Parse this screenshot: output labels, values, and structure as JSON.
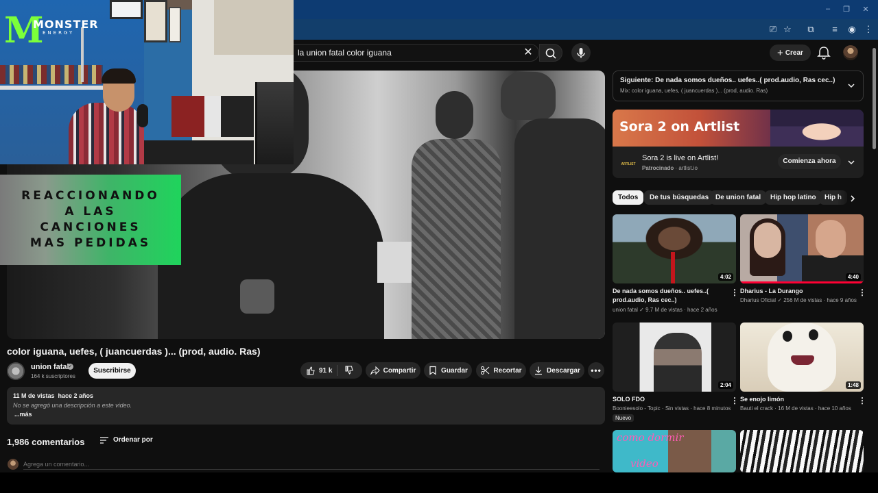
{
  "colors": {
    "background": "#0f0f0f",
    "chrome_tabstrip": "#0d3b72",
    "chrome_toolbar": "#123e6b",
    "pill": "#272727",
    "text_secondary": "#aaaaaa",
    "progress_red": "#ff0033",
    "logo_green": "#7cff3a",
    "banner_green": "#1fd45c"
  },
  "browser": {
    "window_controls": [
      "minimize-icon",
      "restore-icon",
      "close-icon"
    ],
    "toolbar_icons": [
      "cast-icon",
      "star-icon",
      "extensions-icon",
      "media-queue-icon",
      "profile-icon",
      "menu-icon"
    ]
  },
  "search": {
    "query": "la union fatal color iguana",
    "clear_icon": "close-icon",
    "search_icon": "search-icon",
    "mic_icon": "mic-icon"
  },
  "header": {
    "create_label": "Crear",
    "create_icon": "plus-icon",
    "notifications_icon": "bell-icon",
    "avatar_icon": "user-avatar"
  },
  "overlay": {
    "logo_mark": "M",
    "logo_text": "MONSTER",
    "logo_sub": "ENERGY",
    "banner_lines": [
      "REACCIONANDO",
      "A LAS",
      "CANCIONES",
      "MAS PEDIDAS"
    ]
  },
  "video": {
    "title": "color iguana, uefes, ( juancuerdas )... (prod, audio. Ras)",
    "channel": "union fatal",
    "subscribers": "164 k suscriptores",
    "subscribe_label": "Suscribirse",
    "likes": "91 k",
    "actions": {
      "share": "Compartir",
      "save": "Guardar",
      "clip": "Recortar",
      "download": "Descargar"
    }
  },
  "description": {
    "stats": "11 M de vistas  hace 2 años",
    "text": "No se agregó una descripción a este video.",
    "more": "...más"
  },
  "comments": {
    "count": "1,986 comentarios",
    "sort_label": "Ordenar por",
    "placeholder": "Agrega un comentario..."
  },
  "up_next": {
    "title": "Siguiente: De nada somos dueños.. uefes..( prod.audio, Ras cec..)",
    "subtitle": "Mix: color iguana, uefes, ( juancuerdas )... (prod, audio. Ras)"
  },
  "ad": {
    "image_text": "Sora 2 on Artlist",
    "logo_text": "ARTLIST",
    "title": "Sora 2 is live on Artlist!",
    "sponsor_label": "Patrocinado",
    "sponsor_domain": "artlist.io",
    "cta": "Comienza ahora"
  },
  "chips": [
    "Todos",
    "De tus búsquedas",
    "De union fatal",
    "Hip hop latino",
    "Hip h"
  ],
  "related": [
    {
      "title": "De nada somos dueños.. uefes..( prod.audio, Ras cec..)",
      "channel": "union fatal",
      "meta": "9.7 M de vistas · hace 2 años",
      "duration": "4:02"
    },
    {
      "title": "Dharius - La Durango",
      "channel": "Dharius Oficial",
      "meta": "256 M de vistas · hace 9 años",
      "duration": "4:40"
    },
    {
      "title": "SOLO FDO",
      "channel": "Boonieesolo - Topic",
      "meta": "Sin vistas · hace 8 minutos",
      "duration": "2:04",
      "badge": "Nuevo"
    },
    {
      "title": "Se enojo limón",
      "channel": "Bauti el crack",
      "meta": "16 M de vistas · hace 10 años",
      "duration": "1:48"
    },
    {
      "title": "",
      "channel": "",
      "meta": "",
      "duration": "",
      "thumb_text": [
        "como dormir",
        "video"
      ]
    },
    {
      "title": "",
      "channel": "",
      "meta": "",
      "duration": ""
    }
  ]
}
